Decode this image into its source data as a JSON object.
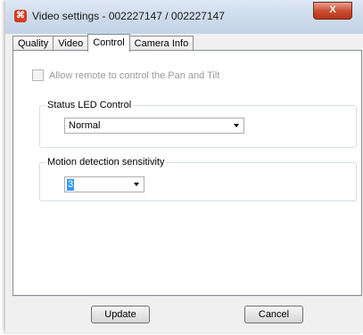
{
  "window": {
    "title": "Video settings - 002227147 / 002227147",
    "app_icon": "webcam-icon",
    "close_label": "X"
  },
  "tabs": [
    {
      "label": "Quality",
      "active": false
    },
    {
      "label": "Video",
      "active": false
    },
    {
      "label": "Control",
      "active": true
    },
    {
      "label": "Camera Info",
      "active": false
    }
  ],
  "control": {
    "remote_checkbox": {
      "label": "Allow remote to control the Pan and Tilt",
      "checked": false,
      "enabled": false
    },
    "status_led": {
      "title": "Status LED Control",
      "value": "Normal"
    },
    "motion": {
      "title": "Motion detection sensitivity",
      "value": "3"
    }
  },
  "buttons": {
    "update": "Update",
    "cancel": "Cancel"
  },
  "colors": {
    "accent_close": "#cd4f35",
    "selection": "#3399ff"
  }
}
